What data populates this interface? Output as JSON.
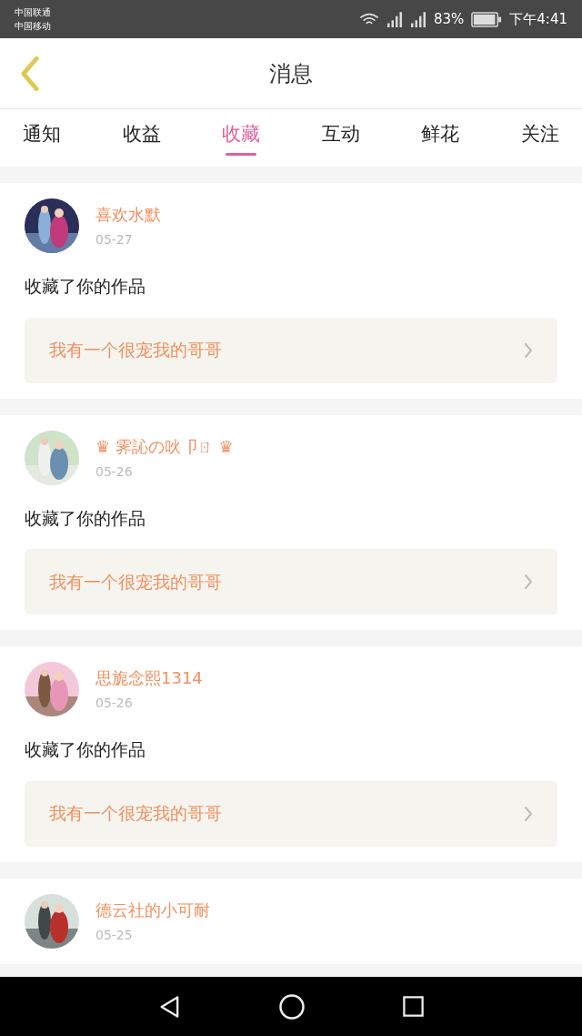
{
  "status_bar": {
    "carriers": [
      "中国联通",
      "中国移动"
    ],
    "battery_text": "83%",
    "time": "下午4:41"
  },
  "header": {
    "title": "消息"
  },
  "tabs": [
    {
      "label": "通知",
      "selected": false
    },
    {
      "label": "收益",
      "selected": false
    },
    {
      "label": "收藏",
      "selected": true
    },
    {
      "label": "互动",
      "selected": false
    },
    {
      "label": "鲜花",
      "selected": false
    },
    {
      "label": "关注",
      "selected": false
    }
  ],
  "messages": [
    {
      "name": "喜欢水默",
      "date": "05-27",
      "text": "收藏了你的作品",
      "work": "我有一个很宠我的哥哥"
    },
    {
      "name": "♛ 霁訫の吙卩ㄖ ♛",
      "date": "05-26",
      "text": "收藏了你的作品",
      "work": "我有一个很宠我的哥哥"
    },
    {
      "name": "思旎念熙1314",
      "date": "05-26",
      "text": "收藏了你的作品",
      "work": "我有一个很宠我的哥哥"
    },
    {
      "name": "德云社的小可耐",
      "date": "05-25"
    }
  ]
}
